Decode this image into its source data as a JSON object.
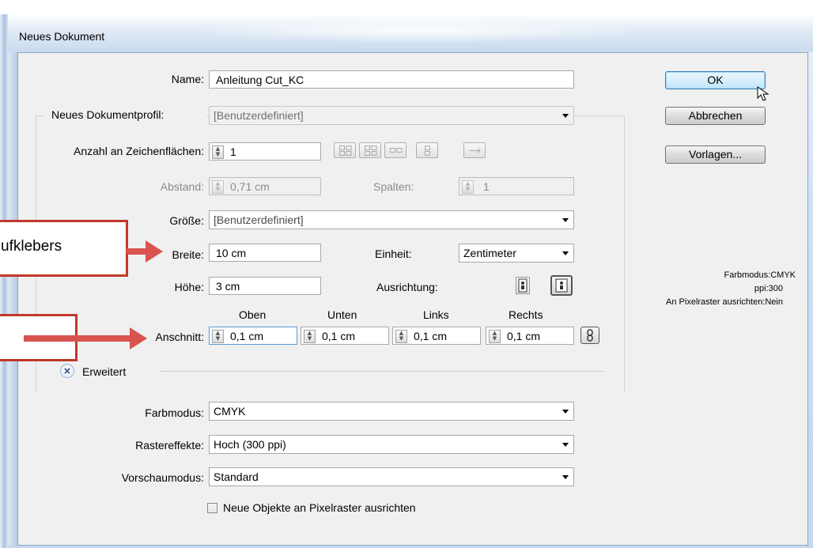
{
  "window": {
    "title": "Neues Dokument"
  },
  "buttons": {
    "ok": "OK",
    "cancel": "Abbrechen",
    "templates": "Vorlagen..."
  },
  "name": {
    "label": "Name:",
    "value": "Anleitung Cut_KC"
  },
  "profile": {
    "label": "Neues Dokumentprofil:",
    "value": "[Benutzerdefiniert]"
  },
  "artboards": {
    "label": "Anzahl an Zeichenflächen:",
    "value": "1"
  },
  "spacing": {
    "label": "Abstand:",
    "value": "0,71 cm"
  },
  "columns": {
    "label": "Spalten:",
    "value": "1"
  },
  "size": {
    "label": "Größe:",
    "value": "[Benutzerdefiniert]"
  },
  "width": {
    "label": "Breite:",
    "value": "10 cm"
  },
  "height": {
    "label": "Höhe:",
    "value": "3 cm"
  },
  "unit": {
    "label": "Einheit:",
    "value": "Zentimeter"
  },
  "orientation": {
    "label": "Ausrichtung:"
  },
  "bleed": {
    "label": "Anschnitt:",
    "headers": [
      "Oben",
      "Unten",
      "Links",
      "Rechts"
    ],
    "values": [
      "0,1 cm",
      "0,1 cm",
      "0,1 cm",
      "0,1 cm"
    ]
  },
  "advanced": {
    "label": "Erweitert",
    "color_mode": {
      "label": "Farbmodus:",
      "value": "CMYK"
    },
    "raster_effects": {
      "label": "Rastereffekte:",
      "value": "Hoch (300 ppi)"
    },
    "preview_mode": {
      "label": "Vorschaumodus:",
      "value": "Standard"
    },
    "pixel_grid_checkbox": "Neue Objekte an Pixelraster ausrichten"
  },
  "info": {
    "color_mode": "Farbmodus:CMYK",
    "ppi": "ppi:300",
    "pixel_grid": "An Pixelraster ausrichten:Nein"
  },
  "annotations": {
    "callout_1": "ufklebers",
    "callout_2": ""
  },
  "colors": {
    "annotation_red": "#d9534f",
    "default_button_border": "#3c7fb1"
  }
}
